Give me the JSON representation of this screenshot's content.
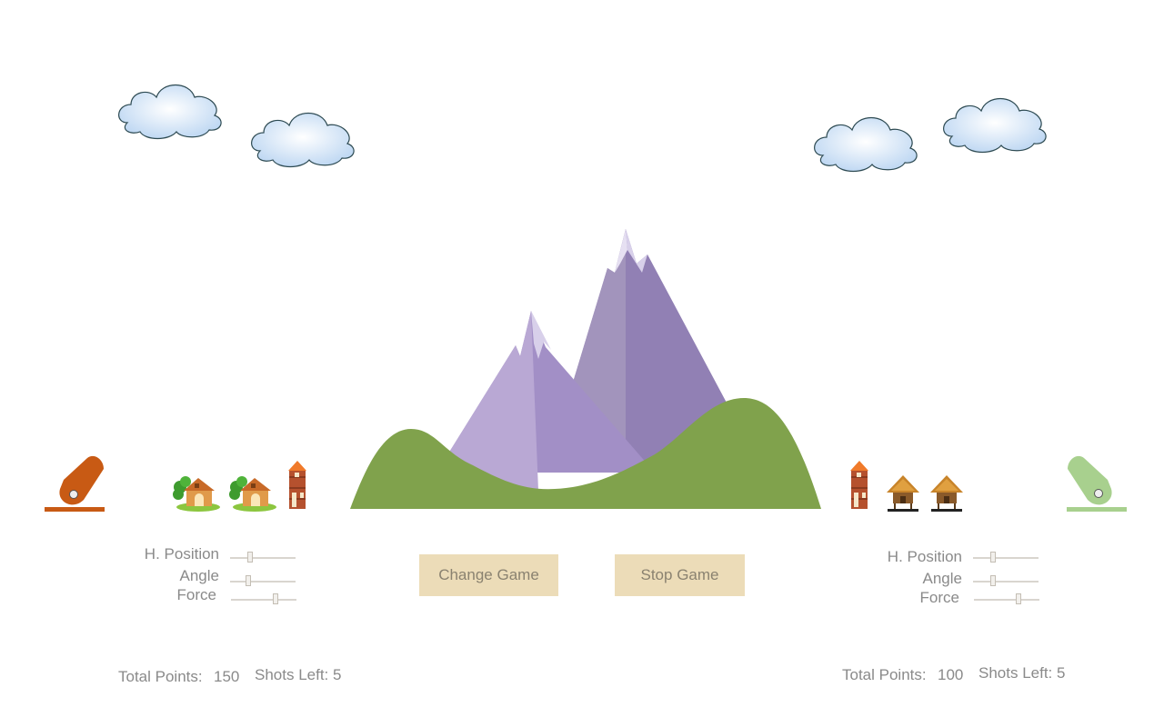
{
  "left_player": {
    "controls": {
      "h_position_label": "H. Position",
      "angle_label": "Angle",
      "force_label": "Force"
    },
    "sliders": {
      "h_position": 0.3,
      "angle": 0.28,
      "force": 0.68
    },
    "score": {
      "total_points_label": "Total Points:",
      "total_points_value": "150",
      "shots_left_label": "Shots Left: 5"
    },
    "cannon_color": "#c85a14"
  },
  "right_player": {
    "controls": {
      "h_position_label": "H. Position",
      "angle_label": "Angle",
      "force_label": "Force"
    },
    "sliders": {
      "h_position": 0.3,
      "angle": 0.3,
      "force": 0.68
    },
    "score": {
      "total_points_label": "Total Points:",
      "total_points_value": "100",
      "shots_left_label": "Shots Left: 5"
    },
    "cannon_color": "#a8d08e"
  },
  "buttons": {
    "change_game": "Change Game",
    "stop_game": "Stop Game"
  },
  "colors": {
    "hill": "#80a24c",
    "mountain_light": "#b9a8d4",
    "mountain_mid": "#a28fc6",
    "mountain_dark": "#9180b4",
    "snow": "#d8d0ea",
    "button_bg": "#ecdcb8"
  }
}
